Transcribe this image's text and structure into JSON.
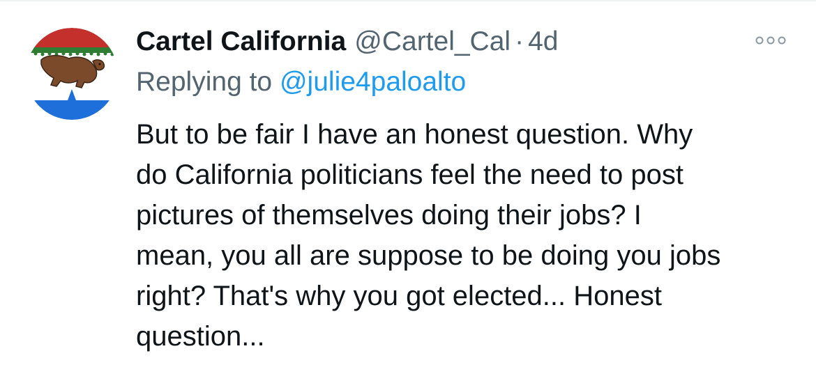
{
  "tweet": {
    "display_name": "Cartel California",
    "handle": "@Cartel_Cal",
    "separator": "·",
    "timestamp": "4d",
    "replying_prefix": "Replying to",
    "replying_to": "@julie4paloalto",
    "text": "But to be fair I have an honest question. Why\ndo California politicians feel the need to post\npictures of themselves doing their jobs? I\nmean, you all are suppose to be doing you jobs\nright? That's why you got elected... Honest\nquestion..."
  },
  "icons": {
    "avatar": "california-bear-flag-avatar",
    "more": "more-horizontal-icon"
  },
  "colors": {
    "text_primary": "#0f1419",
    "text_secondary": "#536471",
    "link": "#1d9bf0",
    "avatar_red": "#c4302b",
    "avatar_green": "#2e7d32",
    "avatar_blue": "#1e6fd9",
    "avatar_bear": "#7a4a2a"
  }
}
